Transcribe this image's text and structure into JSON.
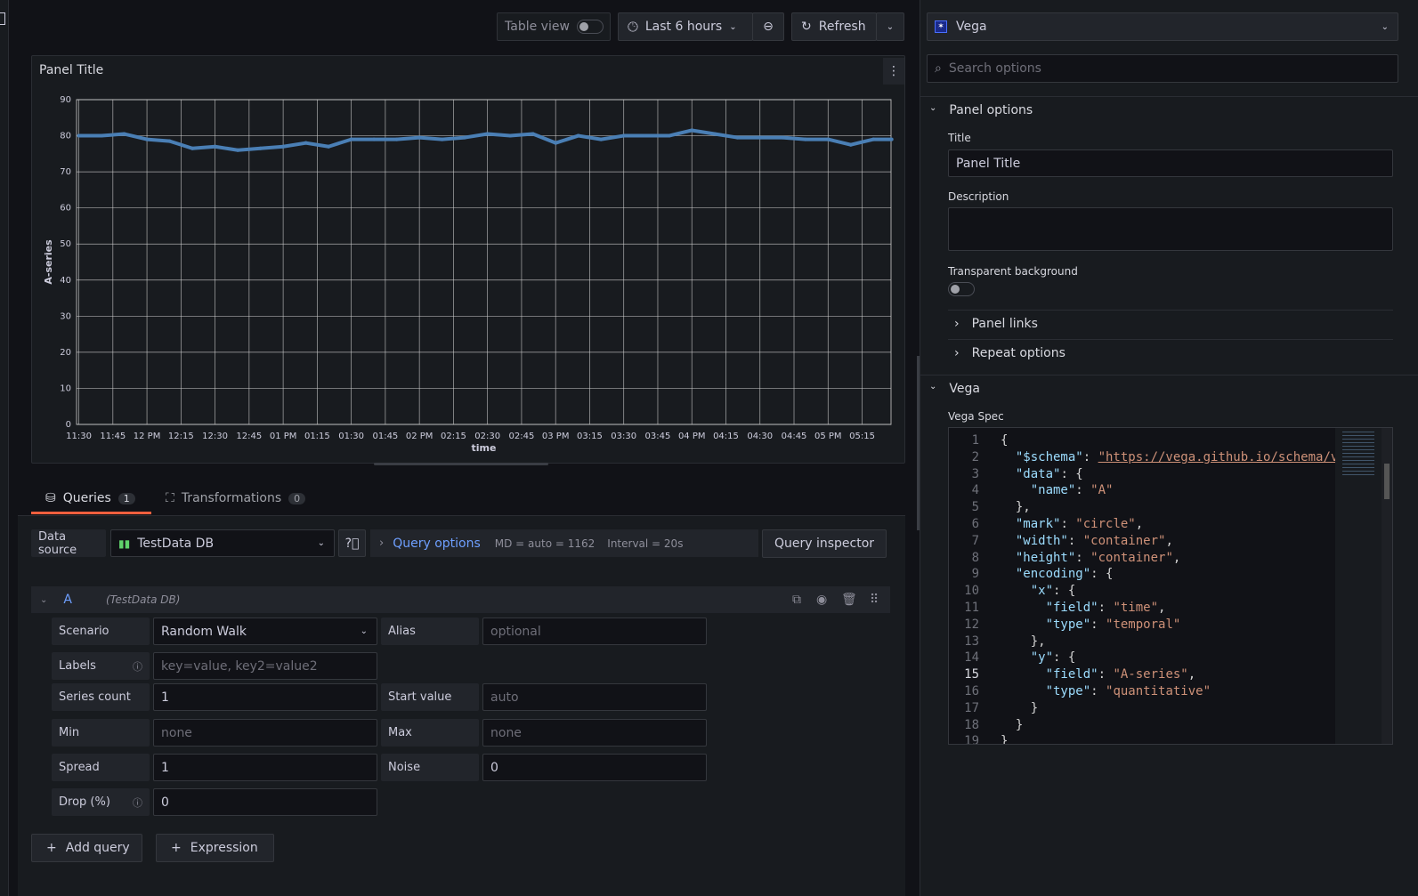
{
  "toolbar": {
    "table_view": "Table view",
    "time_range": "Last 6 hours",
    "refresh": "Refresh"
  },
  "panel": {
    "title": "Panel Title"
  },
  "chart_data": {
    "type": "line",
    "title": "",
    "xlabel": "time",
    "ylabel": "A-series",
    "ylim": [
      0,
      90
    ],
    "grid": true,
    "yticks": [
      0,
      10,
      20,
      30,
      40,
      50,
      60,
      70,
      80,
      90
    ],
    "xticks": [
      "11:30",
      "11:45",
      "12 PM",
      "12:15",
      "12:30",
      "12:45",
      "01 PM",
      "01:15",
      "01:30",
      "01:45",
      "02 PM",
      "02:15",
      "02:30",
      "02:45",
      "03 PM",
      "03:15",
      "03:30",
      "03:45",
      "04 PM",
      "04:15",
      "04:30",
      "04:45",
      "05 PM",
      "05:15"
    ],
    "color": "#4a7fb5",
    "x": [
      "11:30",
      "11:40",
      "11:50",
      "12:00",
      "12:10",
      "12:20",
      "12:30",
      "12:40",
      "12:50",
      "13:00",
      "13:10",
      "13:20",
      "13:30",
      "13:40",
      "13:50",
      "14:00",
      "14:10",
      "14:20",
      "14:30",
      "14:40",
      "14:50",
      "15:00",
      "15:10",
      "15:20",
      "15:30",
      "15:40",
      "15:50",
      "16:00",
      "16:10",
      "16:20",
      "16:30",
      "16:40",
      "16:50",
      "17:00",
      "17:10",
      "17:20",
      "17:28"
    ],
    "values": [
      80,
      80,
      80.5,
      79,
      78.5,
      76.5,
      77,
      76,
      76.5,
      77,
      78,
      77,
      79,
      79,
      79,
      79.5,
      79,
      79.5,
      80.5,
      80,
      80.5,
      78,
      80,
      79,
      80,
      80,
      80,
      81.5,
      80.5,
      79.5,
      79.5,
      79.5,
      79,
      79,
      77.5,
      79,
      79
    ]
  },
  "tabs": [
    {
      "label": "Queries",
      "count": "1"
    },
    {
      "label": "Transformations",
      "count": "0"
    }
  ],
  "query_bar": {
    "ds_label": "Data source",
    "ds_value": "TestData DB",
    "query_options": "Query options",
    "md": "MD = auto = 1162",
    "interval": "Interval = 20s",
    "inspector": "Query inspector"
  },
  "query": {
    "ref": "A",
    "ds": "(TestData DB)",
    "scenario_label": "Scenario",
    "scenario": "Random Walk",
    "alias_label": "Alias",
    "alias_ph": "optional",
    "labels_label": "Labels",
    "labels_ph": "key=value, key2=value2",
    "series_label": "Series count",
    "series": "1",
    "start_label": "Start value",
    "start_ph": "auto",
    "min_label": "Min",
    "min_ph": "none",
    "max_label": "Max",
    "max_ph": "none",
    "spread_label": "Spread",
    "spread": "1",
    "noise_label": "Noise",
    "noise": "0",
    "drop_label": "Drop (%)",
    "drop": "0"
  },
  "actions": {
    "add_query": "Add query",
    "expression": "Expression"
  },
  "options": {
    "viz": "Vega",
    "search_ph": "Search options",
    "panel_options": "Panel options",
    "title_label": "Title",
    "title_value": "Panel Title",
    "desc_label": "Description",
    "transparent_label": "Transparent background",
    "panel_links": "Panel links",
    "repeat": "Repeat options",
    "vega_section": "Vega",
    "vega_spec": "Vega Spec"
  },
  "code": [
    [
      [
        "p",
        "{"
      ]
    ],
    [
      [
        "p",
        "  "
      ],
      [
        "k",
        "\"$schema\""
      ],
      [
        "p",
        ": "
      ],
      [
        "s",
        "\"https://vega.github.io/schema/ve"
      ]
    ],
    [
      [
        "p",
        "  "
      ],
      [
        "k",
        "\"data\""
      ],
      [
        "p",
        ": {"
      ]
    ],
    [
      [
        "p",
        "    "
      ],
      [
        "k",
        "\"name\""
      ],
      [
        "p",
        ": "
      ],
      [
        "s",
        "\"A\""
      ]
    ],
    [
      [
        "p",
        "  },"
      ]
    ],
    [
      [
        "p",
        "  "
      ],
      [
        "k",
        "\"mark\""
      ],
      [
        "p",
        ": "
      ],
      [
        "s",
        "\"circle\""
      ],
      [
        "p",
        ","
      ]
    ],
    [
      [
        "p",
        "  "
      ],
      [
        "k",
        "\"width\""
      ],
      [
        "p",
        ": "
      ],
      [
        "s",
        "\"container\""
      ],
      [
        "p",
        ","
      ]
    ],
    [
      [
        "p",
        "  "
      ],
      [
        "k",
        "\"height\""
      ],
      [
        "p",
        ": "
      ],
      [
        "s",
        "\"container\""
      ],
      [
        "p",
        ","
      ]
    ],
    [
      [
        "p",
        "  "
      ],
      [
        "k",
        "\"encoding\""
      ],
      [
        "p",
        ": {"
      ]
    ],
    [
      [
        "p",
        "    "
      ],
      [
        "k",
        "\"x\""
      ],
      [
        "p",
        ": {"
      ]
    ],
    [
      [
        "p",
        "      "
      ],
      [
        "k",
        "\"field\""
      ],
      [
        "p",
        ": "
      ],
      [
        "s",
        "\"time\""
      ],
      [
        "p",
        ","
      ]
    ],
    [
      [
        "p",
        "      "
      ],
      [
        "k",
        "\"type\""
      ],
      [
        "p",
        ": "
      ],
      [
        "s",
        "\"temporal\""
      ]
    ],
    [
      [
        "p",
        "    },"
      ]
    ],
    [
      [
        "p",
        "    "
      ],
      [
        "k",
        "\"y\""
      ],
      [
        "p",
        ": {"
      ]
    ],
    [
      [
        "p",
        "      "
      ],
      [
        "k",
        "\"field\""
      ],
      [
        "p",
        ": "
      ],
      [
        "s",
        "\"A-series\""
      ],
      [
        "p",
        ","
      ]
    ],
    [
      [
        "p",
        "      "
      ],
      [
        "k",
        "\"type\""
      ],
      [
        "p",
        ": "
      ],
      [
        "s",
        "\"quantitative\""
      ]
    ],
    [
      [
        "p",
        "    }"
      ]
    ],
    [
      [
        "p",
        "  }"
      ]
    ],
    [
      [
        "p",
        "}"
      ]
    ]
  ]
}
